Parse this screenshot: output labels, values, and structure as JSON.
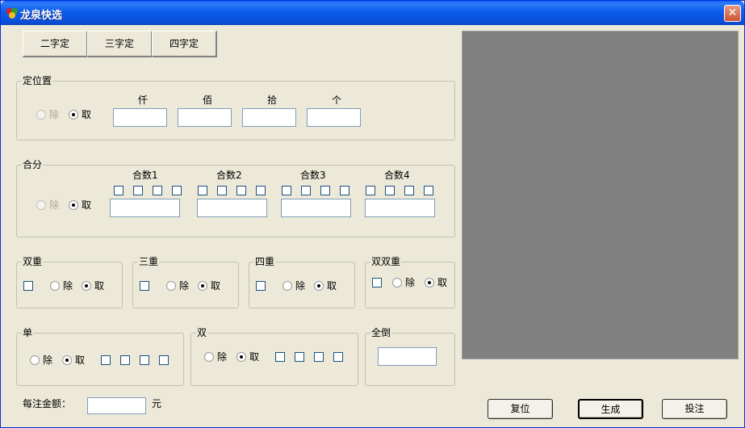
{
  "window": {
    "title": "龙泉快选",
    "close_glyph": "✕",
    "app_icon": "app-logo-icon"
  },
  "tabs": [
    {
      "label": "二字定"
    },
    {
      "label": "三字定"
    },
    {
      "label": "四字定"
    }
  ],
  "position_group": {
    "title": "定位置",
    "exclude": "除",
    "take": "取",
    "selected": "take",
    "columns": [
      "仟",
      "佰",
      "拾",
      "个"
    ],
    "values": [
      "",
      "",
      "",
      ""
    ]
  },
  "sum_group": {
    "title": "合分",
    "exclude": "除",
    "take": "取",
    "selected": "take",
    "columns": [
      "合数1",
      "合数2",
      "合数3",
      "合数4"
    ],
    "values": [
      "",
      "",
      "",
      ""
    ]
  },
  "double_group": {
    "title": "双重",
    "exclude": "除",
    "take": "取",
    "selected": "take"
  },
  "triple_group": {
    "title": "三重",
    "exclude": "除",
    "take": "取",
    "selected": "take"
  },
  "quad_group": {
    "title": "四重",
    "exclude": "除",
    "take": "取",
    "selected": "take"
  },
  "double_double_group": {
    "title": "双双重",
    "exclude": "除",
    "take": "取",
    "selected": "take"
  },
  "odd_group": {
    "title": "单",
    "exclude": "除",
    "take": "取",
    "selected": "take"
  },
  "even_group": {
    "title": "双",
    "exclude": "除",
    "take": "取",
    "selected": "take"
  },
  "reverse_group": {
    "title": "全倒",
    "value": ""
  },
  "amount": {
    "label": "每注金额：",
    "value": "",
    "unit": "元"
  },
  "buttons": {
    "reset": "复位",
    "generate": "生成",
    "bet": "投注"
  },
  "colors": {
    "preview_bg": "#808080",
    "window_bg": "#ece9d8",
    "titlebar": "#0a5ef7"
  }
}
